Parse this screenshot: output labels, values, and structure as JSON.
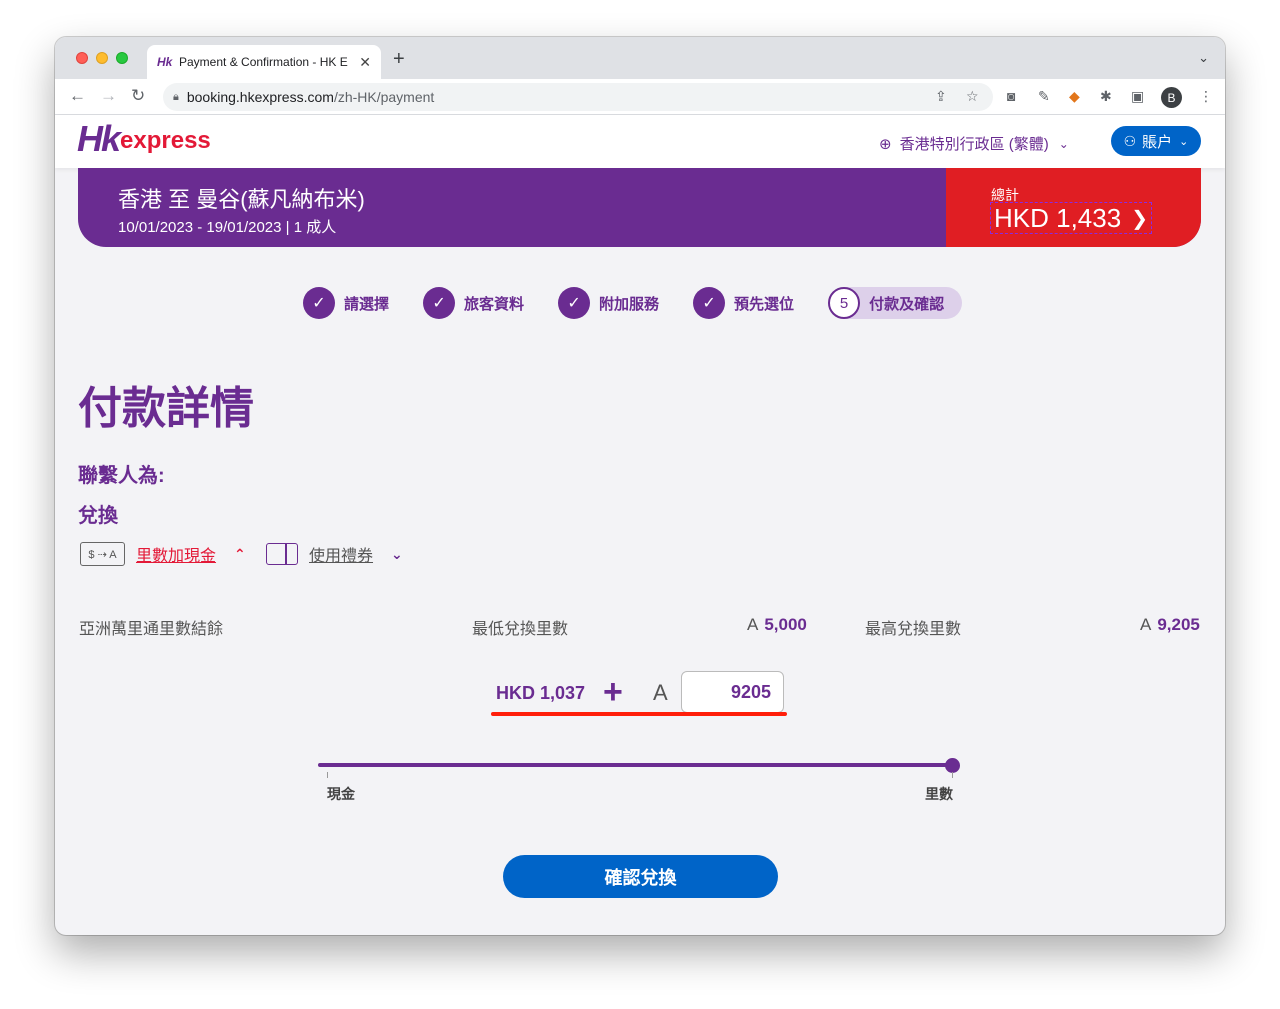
{
  "browser": {
    "tab_title": "Payment & Confirmation - HK E",
    "tab_favicon": "Hk",
    "url_host": "booking.hkexpress.com",
    "url_path": "/zh-HK/payment",
    "profile_initial": "B"
  },
  "header": {
    "logo_hk": "Hk",
    "logo_express": "express",
    "language": "香港特別行政區 (繁體)",
    "account": "賬户"
  },
  "summary": {
    "route": "香港 至 曼谷(蘇凡納布米)",
    "dates": "10/01/2023 - 19/01/2023 | 1 成人",
    "total_label": "總計",
    "total_amount": "HKD 1,433"
  },
  "steps": [
    {
      "label": "請選擇",
      "done": true
    },
    {
      "label": "旅客資料",
      "done": true
    },
    {
      "label": "附加服務",
      "done": true
    },
    {
      "label": "預先選位",
      "done": true
    },
    {
      "label": "付款及確認",
      "number": "5",
      "current": true
    }
  ],
  "main": {
    "title": "付款詳情",
    "contact_label": "聯繫人為:",
    "redeem_label": "兌換",
    "option_miles_cash": "里數加現金",
    "option_miles_icon_text": "$ ⇢ A",
    "option_voucher": "使用禮券",
    "balance_label": "亞洲萬里通里數結餘",
    "min_label": "最低兌換里數",
    "min_value": "5,000",
    "max_label": "最高兌換里數",
    "max_value": "9,205",
    "asia_symbol": "A",
    "cash_amount": "HKD 1,037",
    "plus_sign": "+",
    "miles_value": "9205",
    "slider_min_label": "現金",
    "slider_max_label": "里數",
    "slider_level": 1.0,
    "confirm_button": "確認兌換"
  },
  "colors": {
    "brand_purple": "#6a2c91",
    "total_red": "#e01e23",
    "action_blue": "#0064c8",
    "link_red": "#e31937"
  }
}
